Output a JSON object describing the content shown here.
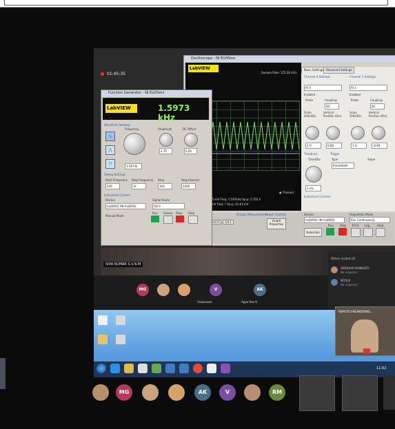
{
  "meeting": {
    "timer": "01:45:35",
    "presenter_label": "SIVA KUMAR S.V.N.M",
    "others_invited_label": "Others invited (2)",
    "invited": [
      {
        "name": "GIRIDHAR MUNIGOTI",
        "status": "No response"
      },
      {
        "name": "NIT020",
        "status": "No response"
      }
    ],
    "video_tile_label": "REMOTE ENGINEERING...",
    "tiles": [
      {
        "initials": "MG",
        "color": "#b43a57"
      },
      {
        "initials": "V",
        "color": "#7a4fa1",
        "name": "Viswanaan"
      },
      {
        "initials": "AK",
        "color": "#4a6f88",
        "name": "Appa Rao K"
      }
    ],
    "bottom_strip": [
      {
        "initials": "MG",
        "color": "#b43a57"
      },
      {
        "initials": "AK",
        "color": "#4a6f88"
      },
      {
        "initials": "V",
        "color": "#7a4fa1"
      },
      {
        "initials": "RM",
        "color": "#6a8a3a"
      }
    ]
  },
  "oscilloscope": {
    "window_title": "Oscilloscope - NI ELVISmx",
    "logo": "LabVIEW",
    "sample_rate": "Sample Rate: 125.00 kS/s",
    "meas_ch0": "CH 0: RMS: 575.30 mV   Freq: 1.597kHz   Vp-p: 2.702 V",
    "meas_ch1": "CH 1: RMS: 4.64 mV    Freq: ?   Vp-p: 22.63 mV",
    "timeout": "Timeout",
    "display_measurements": "Display Measurements",
    "graph_controls": "Graph Controls",
    "ch0": "CH 0",
    "ch1": "CH 1",
    "graph_properties": "Graph Properties",
    "tabs": [
      "Basic Settings",
      "Advanced Settings"
    ],
    "channel0": {
      "title": "Channel 0 Settings",
      "source": "AI 0",
      "enabled": "Enabled",
      "scale": "1 V",
      "position": "0.00"
    },
    "channel1": {
      "title": "Channel 1 Settings",
      "source": "AI 1",
      "enabled": "Enabled",
      "scale": "1 V",
      "position": "-0.94"
    },
    "probe": "Probe",
    "coupling": "Coupling",
    "dc": "DC",
    "scale_label": "Scale Volts/Div",
    "position_label": "Vertical Position (Div)",
    "timebase": "Timebase",
    "time_div": "Time/Div",
    "time_value": "1 ms",
    "trigger": "Trigger",
    "trigger_type": "Type",
    "trigger_value": "Immediate",
    "slope": "Slope",
    "instrument_control": "Instrument Control",
    "device": "Device",
    "device_value": "myDAQ1 (NI myDAQ)",
    "acquisition_mode": "Acquisition Mode",
    "acquisition_value": "Run Continuously",
    "autoscale": "Autoscale",
    "run": "Run",
    "stop": "Stop",
    "print": "Print",
    "log": "Log",
    "help": "Help"
  },
  "function_generator": {
    "window_title": "Function Generator - NI ELVISmx",
    "logo": "LabVIEW",
    "frequency_display": "1.5973 kHz",
    "waveform_settings": "Waveform Settings",
    "frequency": "Frequency",
    "amplitude": "Amplitude",
    "dc_offset": "DC Offset",
    "freq_value": "1.5973k",
    "amp_value": "2.70",
    "offset_value": "0.00",
    "sweep_settings": "Sweep Settings",
    "start_freq": "Start Frequency",
    "start_value": "100",
    "stop_freq": "Stop Frequency",
    "stop_value": "1k",
    "step": "Step",
    "step_value": "100",
    "step_interval": "Step Interval",
    "interval_value": "1000",
    "instrument_control": "Instrument Control",
    "device": "Device",
    "device_value": "myDAQ1 (NI myDAQ)",
    "signal_route": "Signal Route",
    "signal_value": "AO 0",
    "manual_mode": "Manual Mode",
    "run": "Run",
    "sweep": "Sweep",
    "stop": "Stop",
    "help": "Help"
  },
  "taskbar": {
    "time": "11:02",
    "desktop_icons": [
      "Ecommerce...",
      "...",
      "..."
    ]
  }
}
